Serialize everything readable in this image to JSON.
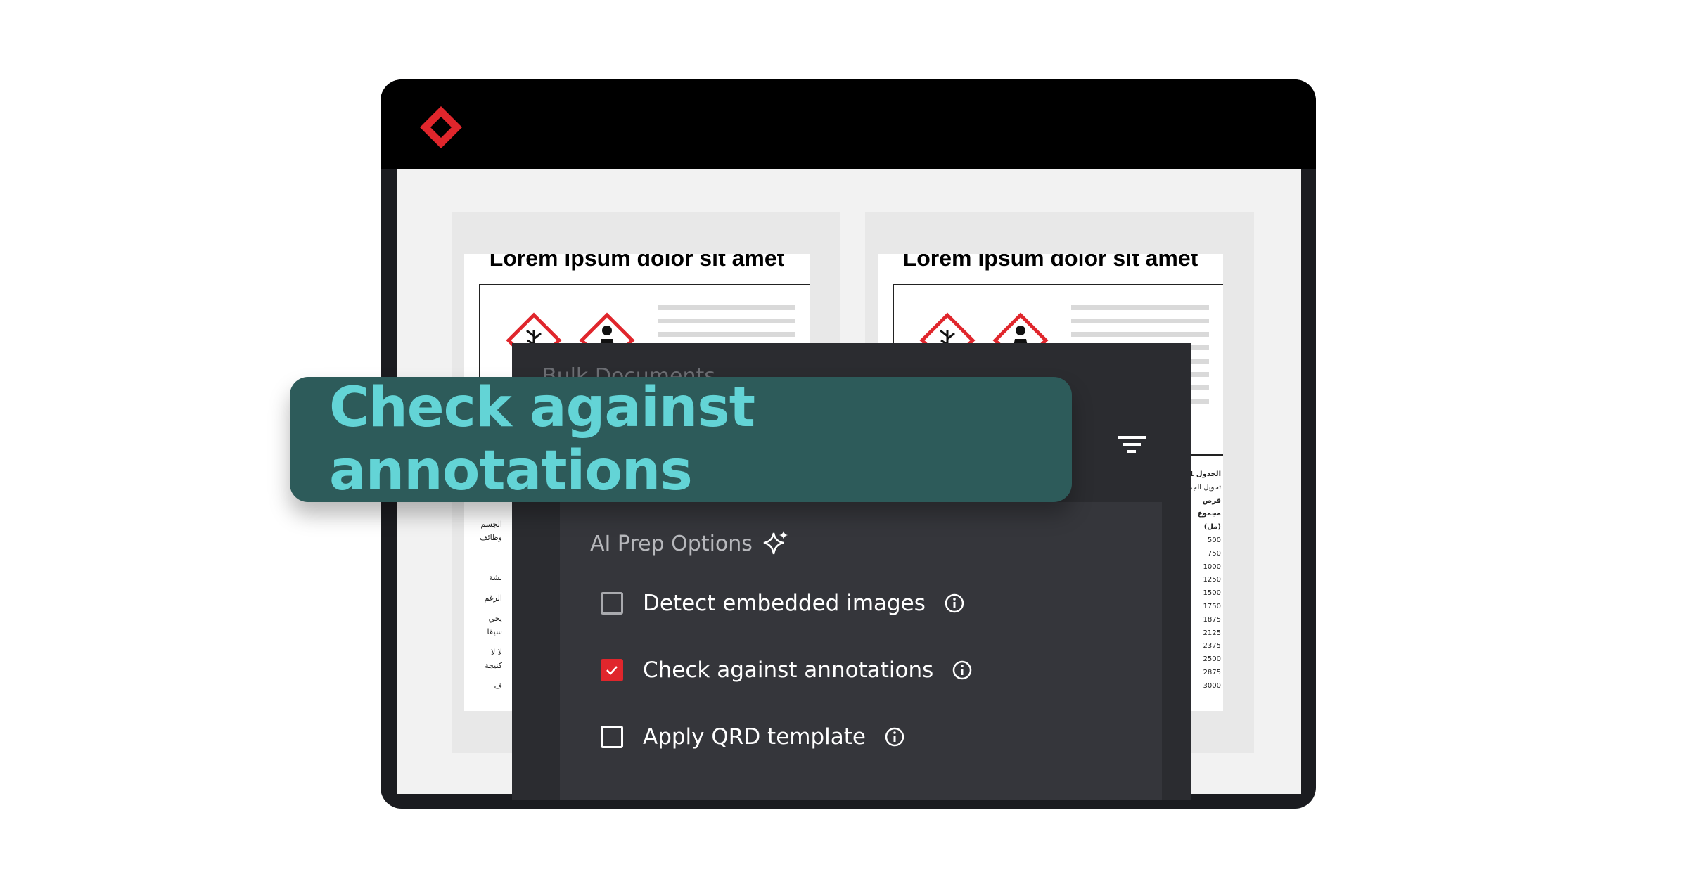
{
  "app": {
    "logo": "red-diamond-logo"
  },
  "documents": [
    {
      "title": "Lorem ipsum dolor sit amet"
    },
    {
      "title": "Lorem ipsum dolor sit amet"
    }
  ],
  "arabic_left": [
    "الجسم",
    "وظائف",
    "بشة",
    "الرغم",
    "يخي",
    "سيقا",
    "لا لا",
    "كنيجة",
    "ف"
  ],
  "arabic_right": [
    "الجدول 1",
    "تحويل الجر",
    "قرص",
    "مجموع",
    "(مل)",
    "500",
    "750",
    "1000",
    "1250",
    "1500",
    "1750",
    "1875",
    "2125",
    "2375",
    "2500",
    "2875",
    "3000"
  ],
  "panel": {
    "ghost_title": "Bulk Documents",
    "filter_icon": "filter-icon",
    "options_title": "AI Prep Options",
    "options": [
      {
        "label": "Detect embedded images",
        "checked": false
      },
      {
        "label": "Check against annotations",
        "checked": true
      },
      {
        "label": "Apply QRD template",
        "checked": false
      }
    ]
  },
  "callout": {
    "text": "Check against annotations"
  },
  "colors": {
    "accent": "#e0262c",
    "callout_bg": "#2d5b5a",
    "callout_text": "#63d4d6"
  }
}
